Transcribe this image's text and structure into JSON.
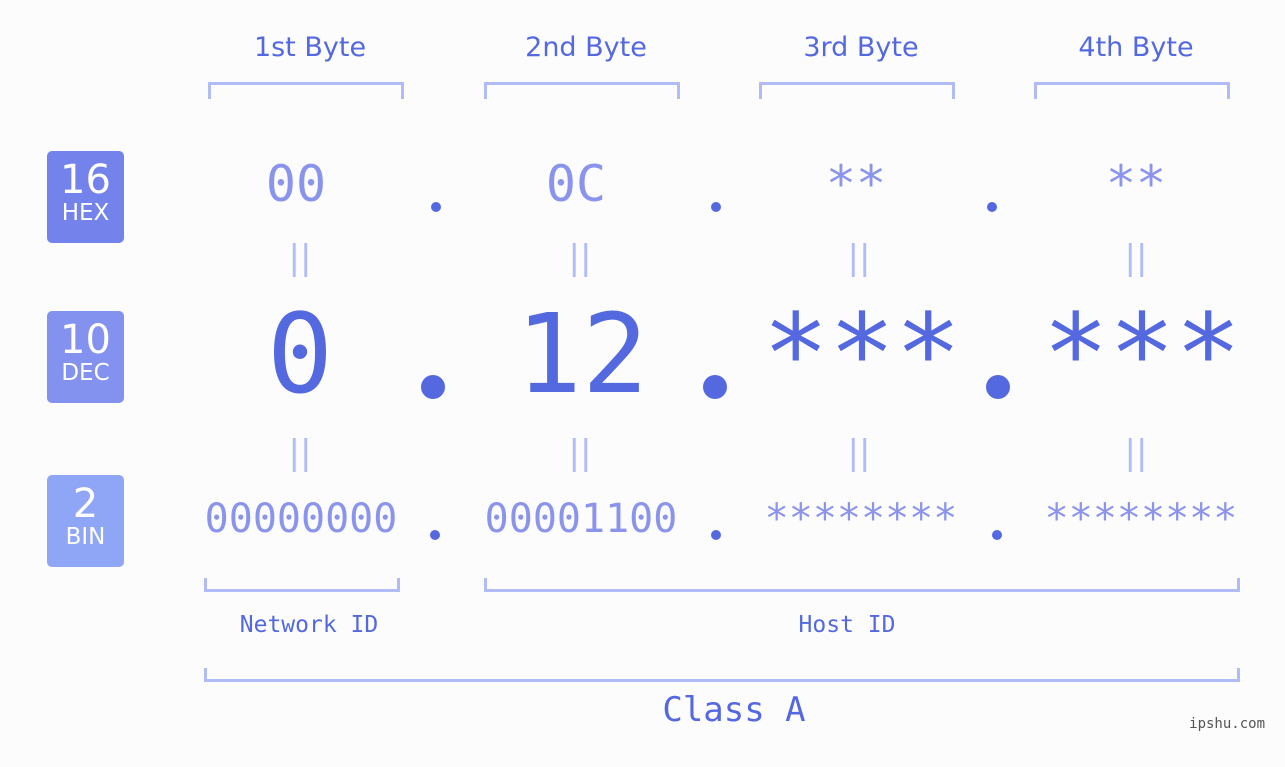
{
  "bytes": [
    {
      "label": "1st Byte",
      "hex": "00",
      "dec": "0",
      "bin": "00000000"
    },
    {
      "label": "2nd Byte",
      "hex": "0C",
      "dec": "12",
      "bin": "00001100"
    },
    {
      "label": "3rd Byte",
      "hex": "**",
      "dec": "***",
      "bin": "********"
    },
    {
      "label": "4th Byte",
      "hex": "**",
      "dec": "***",
      "bin": "********"
    }
  ],
  "bases": [
    {
      "num": "16",
      "name": "HEX",
      "color": "#7383eb"
    },
    {
      "num": "10",
      "name": "DEC",
      "color": "#8391ef"
    },
    {
      "num": "2",
      "name": "BIN",
      "color": "#8fa6f7"
    }
  ],
  "equals_glyph": "||",
  "parts": {
    "network": "Network ID",
    "host": "Host ID"
  },
  "class_label": "Class A",
  "watermark": "ipshu.com"
}
